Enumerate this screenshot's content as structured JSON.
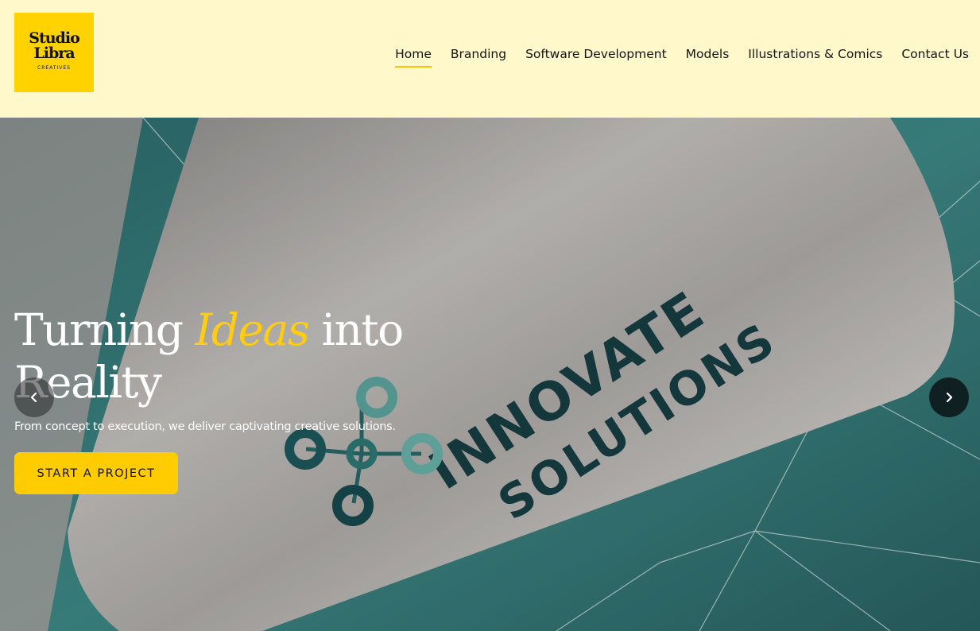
{
  "header": {
    "logo": {
      "line1": "Studio",
      "line2": "Libra",
      "line3": "CREATIVES"
    },
    "nav": [
      {
        "label": "Home",
        "active": true
      },
      {
        "label": "Branding",
        "active": false
      },
      {
        "label": "Software Development",
        "active": false
      },
      {
        "label": "Models",
        "active": false
      },
      {
        "label": "Illustrations & Comics",
        "active": false
      },
      {
        "label": "Contact Us",
        "active": false
      }
    ]
  },
  "hero": {
    "title_prefix": "Turning",
    "title_accent": "Ideas",
    "title_suffix": "into Reality",
    "subtitle": "From concept to execution, we deliver captivating creative solutions.",
    "cta_label": "START A PROJECT",
    "card_text_line1": "INNOVATE",
    "card_text_line2": "SOLUTIONS",
    "prev_icon": "chevron-left-icon",
    "next_icon": "chevron-right-icon"
  },
  "colors": {
    "header_bg": "#fff8cb",
    "brand_yellow": "#ffd200",
    "accent_yellow": "#ffcc11",
    "nav_underline": "#ffc107",
    "teal": "#1f5a5e"
  }
}
